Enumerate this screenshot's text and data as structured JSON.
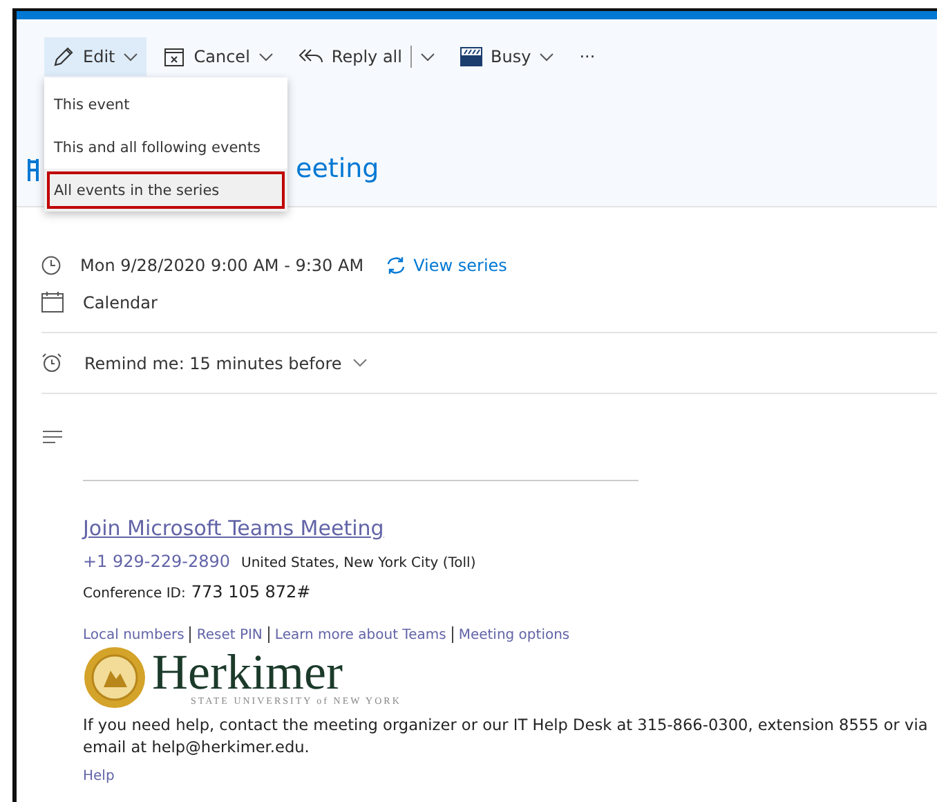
{
  "toolbar": [
    {
      "kind": "edit",
      "label": "Edit",
      "selected": true,
      "caret": true
    },
    {
      "kind": "cancel",
      "label": "Cancel",
      "selected": false,
      "caret": true
    },
    {
      "kind": "reply",
      "label": "Reply all",
      "selected": false,
      "caret": true
    },
    {
      "kind": "busy",
      "label": "Busy",
      "selected": false,
      "caret": true
    },
    {
      "kind": "more",
      "label": "···",
      "selected": false,
      "caret": false
    }
  ],
  "edit_menu": [
    {
      "label": "This event",
      "selected": false
    },
    {
      "label": "This and all following events",
      "selected": false
    },
    {
      "label": "All events in the series",
      "selected": true
    }
  ],
  "title": "eeting",
  "details": [
    {
      "kind": "clock",
      "text": "Mon 9/28/2020 9:00 AM - 9:30 AM",
      "link": "View series"
    },
    {
      "kind": "calendar",
      "text": "Calendar"
    }
  ],
  "reminder": "Remind me: 15 minutes before",
  "body": {
    "join_link": "Join Microsoft Teams Meeting",
    "phone": "+1 929-229-2890",
    "phone_place": "United States, New York City (Toll)",
    "conference_label": "Conference ID:",
    "conference_id": "773 105 872#",
    "links": [
      "Local numbers",
      "Reset PIN",
      "Learn more about Teams",
      "Meeting options"
    ],
    "logo_name": "Herkimer",
    "logo_sub": "STATE UNIVERSITY of NEW YORK",
    "help_text": "If you need help, contact the meeting organizer or our IT Help Desk at 315-866-0300, extension 8555 or via email at help@herkimer.edu.",
    "help_link": "Help"
  }
}
